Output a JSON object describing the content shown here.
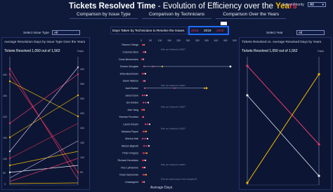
{
  "header": {
    "title_main": "Tickets Resolved Time",
    "title_rest": "- Evolution of Efficiency over the",
    "title_yea": "Yea",
    "title_rs": "rs",
    "tabs": [
      "Comparison by Issue Type",
      "Comparison by Technicians",
      "Comparison Over the Years"
    ],
    "priority_label": "Select Priority",
    "priority_value": "All"
  },
  "left_panel": {
    "issue_label": "Select Issue Type",
    "issue_value": "All",
    "title": "Average Resolution Days by Issue Type Over the Years",
    "tickets_label": "Tickets Resolved 1,050 out of 1,562",
    "days_label": "Days",
    "left_axis": [
      "300",
      "250",
      "200",
      "150",
      "100",
      "50",
      "0"
    ],
    "right_axis": [
      "400",
      "350",
      "300",
      "250",
      "200",
      "150",
      "100",
      "50"
    ]
  },
  "middle_panel": {
    "title": "Days Taken by Technicians to Resolve the Issues",
    "years": [
      "2018",
      "2019",
      "2020"
    ],
    "year_colors": [
      "#e83a6a",
      "#f2b705",
      "#e03050"
    ],
    "axis_top": [
      "0",
      "50",
      "100",
      "150",
      "200",
      "250",
      "300",
      "350",
      "400",
      "450",
      "500"
    ],
    "axis_title": "Average Days",
    "technicians": [
      "Ramon Ortega",
      "Coleman Bion",
      "Doris Bermendes",
      "Doreen Douglas",
      "Erika Bachmeier",
      "Gavin Watson",
      "Jack Barker",
      "Jared Dunn",
      "Ian Holden",
      "Jian Yang",
      "Keenan Fecolear",
      "Laurie Bream",
      "Mariana Payne",
      "Monica Hall",
      "Nelson Bighetti",
      "Peter Gregory",
      "Richard Hendricks",
      "Ron LaFlamme",
      "Russ Hanneman",
      "Unassigned"
    ],
    "notes": [
      "Why not Unlisted in 2020?",
      "Why not Unlisted in 2020?",
      "Why not Unlisted in 2020?",
      "Why not Unlisted in 2020?",
      "Why not Unlisted in 2020?",
      "Why the tasks haven't been assigned?"
    ]
  },
  "right_panel": {
    "year_label": "Select Year",
    "year_value": "All",
    "title": "Tickets Resolved vs. Average Resolved Days by Years",
    "tickets_label": "Tickets Resolved 1,050 out of 1,562",
    "days_label": "Days"
  }
}
